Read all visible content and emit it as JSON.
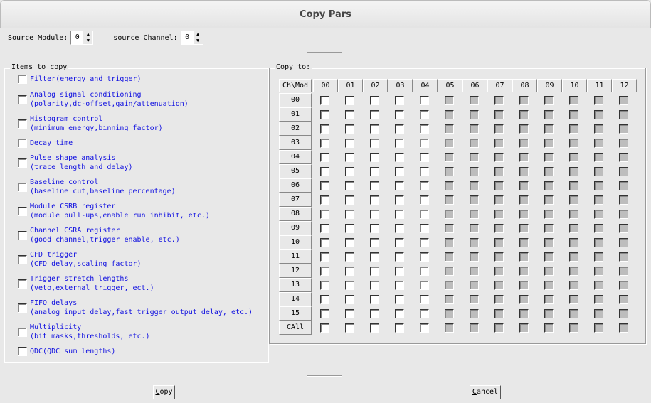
{
  "window": {
    "title": "Copy Pars"
  },
  "source": {
    "module_label": "Source Module:",
    "module_value": "0",
    "channel_label": "source Channel:",
    "channel_value": "0"
  },
  "items_group": {
    "title": "Items to copy",
    "items": [
      {
        "line1": "Filter(energy and trigger)",
        "line2": "",
        "checked": false
      },
      {
        "line1": "Analog signal conditioning",
        "line2": "(polarity,dc-offset,gain/attenuation)",
        "checked": false
      },
      {
        "line1": "Histogram control",
        "line2": "(minimum energy,binning factor)",
        "checked": false
      },
      {
        "line1": "Decay time",
        "line2": "",
        "checked": false
      },
      {
        "line1": "Pulse shape analysis",
        "line2": "(trace length and delay)",
        "checked": false
      },
      {
        "line1": "Baseline control",
        "line2": "(baseline cut,baseline percentage)",
        "checked": false
      },
      {
        "line1": "Module CSRB register",
        "line2": "(module pull-ups,enable run inhibit, etc.)",
        "checked": false
      },
      {
        "line1": "Channel CSRA register",
        "line2": "(good channel,trigger enable, etc.)",
        "checked": false
      },
      {
        "line1": "CFD trigger",
        "line2": "(CFD delay,scaling factor)",
        "checked": false
      },
      {
        "line1": "Trigger stretch lengths",
        "line2": "(veto,external trigger, ect.)",
        "checked": false
      },
      {
        "line1": "FIFO delays",
        "line2": "(analog input delay,fast trigger output delay, etc.)",
        "checked": false
      },
      {
        "line1": "Multiplicity",
        "line2": "(bit masks,thresholds, etc.)",
        "checked": false
      },
      {
        "line1": "QDC(QDC sum lengths)",
        "line2": "",
        "checked": false
      }
    ]
  },
  "copy_to": {
    "title": "Copy to:",
    "corner": "Ch\\Mod",
    "modules": [
      "00",
      "01",
      "02",
      "03",
      "04",
      "05",
      "06",
      "07",
      "08",
      "09",
      "10",
      "11",
      "12"
    ],
    "enabled_modules": [
      "00",
      "01",
      "02",
      "03",
      "04"
    ],
    "channels": [
      "00",
      "01",
      "02",
      "03",
      "04",
      "05",
      "06",
      "07",
      "08",
      "09",
      "10",
      "11",
      "12",
      "13",
      "14",
      "15",
      "CAll"
    ]
  },
  "buttons": {
    "copy_first": "C",
    "copy_rest": "opy",
    "cancel_first": "C",
    "cancel_rest": "ancel"
  }
}
